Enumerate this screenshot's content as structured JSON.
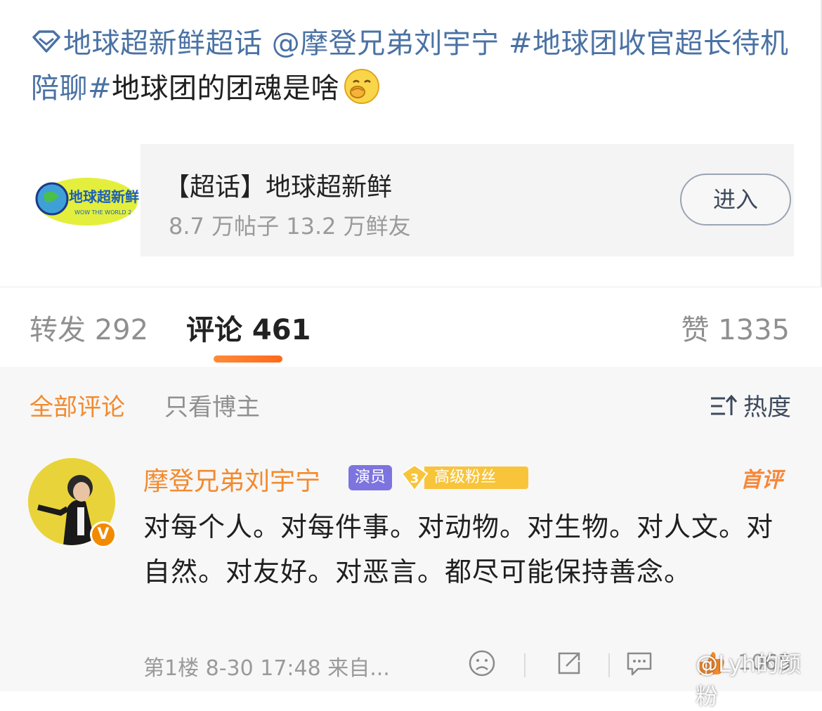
{
  "post": {
    "topic_link": "地球超新鲜超话",
    "mention": "@摩登兄弟刘宇宁",
    "hashtag": "#地球团收官超长待机陪聊#",
    "body": "地球团的团魂是啥"
  },
  "topic_card": {
    "title": "【超话】地球超新鲜",
    "stats": "8.7 万帖子  13.2 万鲜友",
    "enter_label": "进入",
    "thumb_text": "地球超新鲜",
    "thumb_subtext": "WOW THE WORLD 2"
  },
  "tabs": {
    "repost": "转发 292",
    "comments": "评论 461",
    "likes": "赞 1335"
  },
  "filters": {
    "all": "全部评论",
    "owner_only": "只看博主",
    "sort": "热度"
  },
  "comment": {
    "author": "摩登兄弟刘宇宁",
    "badge_role": "演员",
    "fan_level": "3",
    "fan_label": "高级粉丝",
    "first_tag": "首评",
    "text": "对每个人。对每件事。对动物。对生物。对人文。对自然。对友好。对恶言。都尽可能保持善念。",
    "meta": "第1楼 8-30 17:48 来自...",
    "like_count": "1065"
  },
  "watermark": "@Lyh的颜粉",
  "colors": {
    "link": "#4a72a4",
    "accent_orange": "#f28a2e",
    "actor_badge": "#7d74e0",
    "fan_badge": "#f8c43a"
  },
  "icons": [
    "diamond-icon",
    "yawn-emoji-icon",
    "sort-icon",
    "verified-v-icon",
    "dislike-face-icon",
    "share-icon",
    "comment-icon",
    "thumb-up-icon"
  ]
}
